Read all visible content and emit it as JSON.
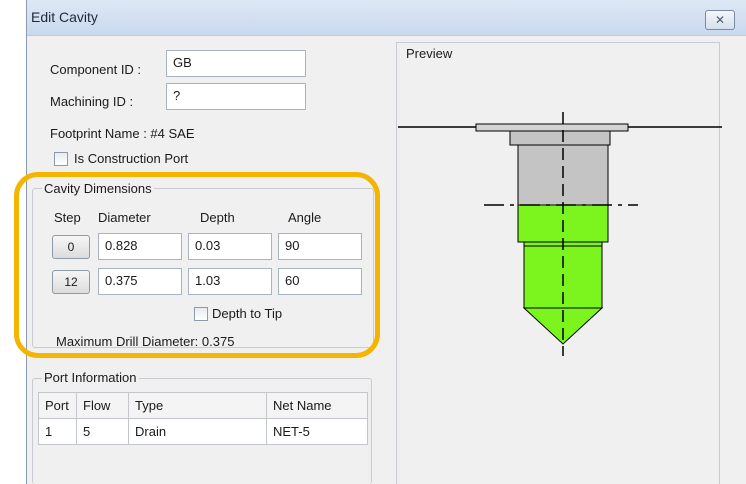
{
  "window": {
    "title": "Edit Cavity",
    "close_glyph": "✕"
  },
  "component_id": {
    "label": "Component ID :",
    "value": "GB"
  },
  "machining_id": {
    "label": "Machining ID :",
    "value": "?"
  },
  "footprint": {
    "label": "Footprint Name : #4 SAE"
  },
  "construction_port": {
    "label": "Is Construction Port",
    "checked": false
  },
  "cavity": {
    "title": "Cavity Dimensions",
    "headers": {
      "step": "Step",
      "diameter": "Diameter",
      "depth": "Depth",
      "angle": "Angle"
    },
    "rows": [
      {
        "step": "0",
        "diameter": "0.828",
        "depth": "0.03",
        "angle": "90"
      },
      {
        "step": "12",
        "diameter": "0.375",
        "depth": "1.03",
        "angle": "60"
      }
    ],
    "depth_to_tip": {
      "label": "Depth to Tip",
      "checked": false
    },
    "max_drill": "Maximum Drill Diameter: 0.375"
  },
  "port_info": {
    "title": "Port Information",
    "columns": [
      "Port",
      "Flow",
      "Type",
      "Net Name"
    ],
    "rows": [
      [
        "1",
        "5",
        "Drain",
        "NET-5"
      ]
    ]
  },
  "preview": {
    "title": "Preview"
  },
  "colors": {
    "highlight": "#f5b400",
    "cavity_fill": "#7cf51e",
    "step_fill": "#c4c4c4"
  }
}
